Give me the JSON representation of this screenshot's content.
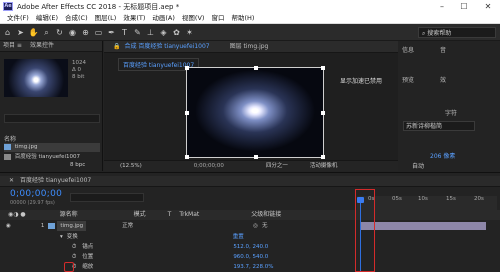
{
  "window": {
    "app_icon": "Ae",
    "title": "Adobe After Effects CC 2018 - 无标题项目.aep *",
    "minimize": "–",
    "maximize": "☐",
    "close": "✕"
  },
  "menu": [
    "文件(F)",
    "编辑(E)",
    "合成(C)",
    "图层(L)",
    "效果(T)",
    "动画(A)",
    "视图(V)",
    "窗口",
    "帮助(H)"
  ],
  "toolbar": {
    "search_help": "搜索帮助"
  },
  "project_panel": {
    "tab_label": "项目 ≡",
    "tab2_label": "效果控件",
    "meta_lines": [
      "1024",
      "Δ 0",
      "8 bit"
    ],
    "column_name": "名称",
    "items": [
      {
        "name": "timg.jpg",
        "color": "#6fa2d8"
      },
      {
        "name": "百度经验 tianyuefei1007",
        "color": "#c8c8c8"
      }
    ],
    "footer_bpc": "8 bpc"
  },
  "composition_panel": {
    "tab_label": "合成 百度经验 tianyuefei1007",
    "tab_layer": "图层 timg.jpg",
    "breadcrumb": "百度经验 tianyuefei1007",
    "tooltip": "显示加速已禁用",
    "footer": {
      "zoom": "(12.5%)",
      "timecode": "0;00;00;00",
      "resolution": "四分之一",
      "camera": "活动摄像机"
    }
  },
  "right_panel": {
    "tab_info": "信息",
    "tab_audio": "音",
    "tab_preview": "预览",
    "tab_effects": "效",
    "tab_char": "字符",
    "font_name": "苏新诗柳楷简",
    "font_size": "206 像素",
    "tracking": "自动"
  },
  "timeline": {
    "tab_label": "百度经验 tianyuefei1007",
    "timecode": "0;00;00;00",
    "timecode_sub": "00000 (29.97 fps)",
    "search_placeholder": "",
    "columns": {
      "source": "源名称",
      "mode": "模式",
      "t": "T",
      "trkmat": "TrkMat",
      "parent": "父级和链接"
    },
    "layers": [
      {
        "num": "1",
        "name": "timg.jpg",
        "mode": "正常",
        "parent": "无"
      }
    ],
    "properties": [
      {
        "name": "变换",
        "value": "重置"
      },
      {
        "name": "锚点",
        "value": "512.0, 240.0"
      },
      {
        "name": "位置",
        "value": "960.0, 540.0"
      },
      {
        "name": "缩放",
        "value": "193.7, 228.0%"
      }
    ],
    "ruler": [
      "0s",
      "05s",
      "10s",
      "15s",
      "20s"
    ]
  },
  "colors": {
    "accent_blue": "#3d8dff",
    "highlight_red": "#d32b2b",
    "track_purple": "#8d86a8"
  }
}
